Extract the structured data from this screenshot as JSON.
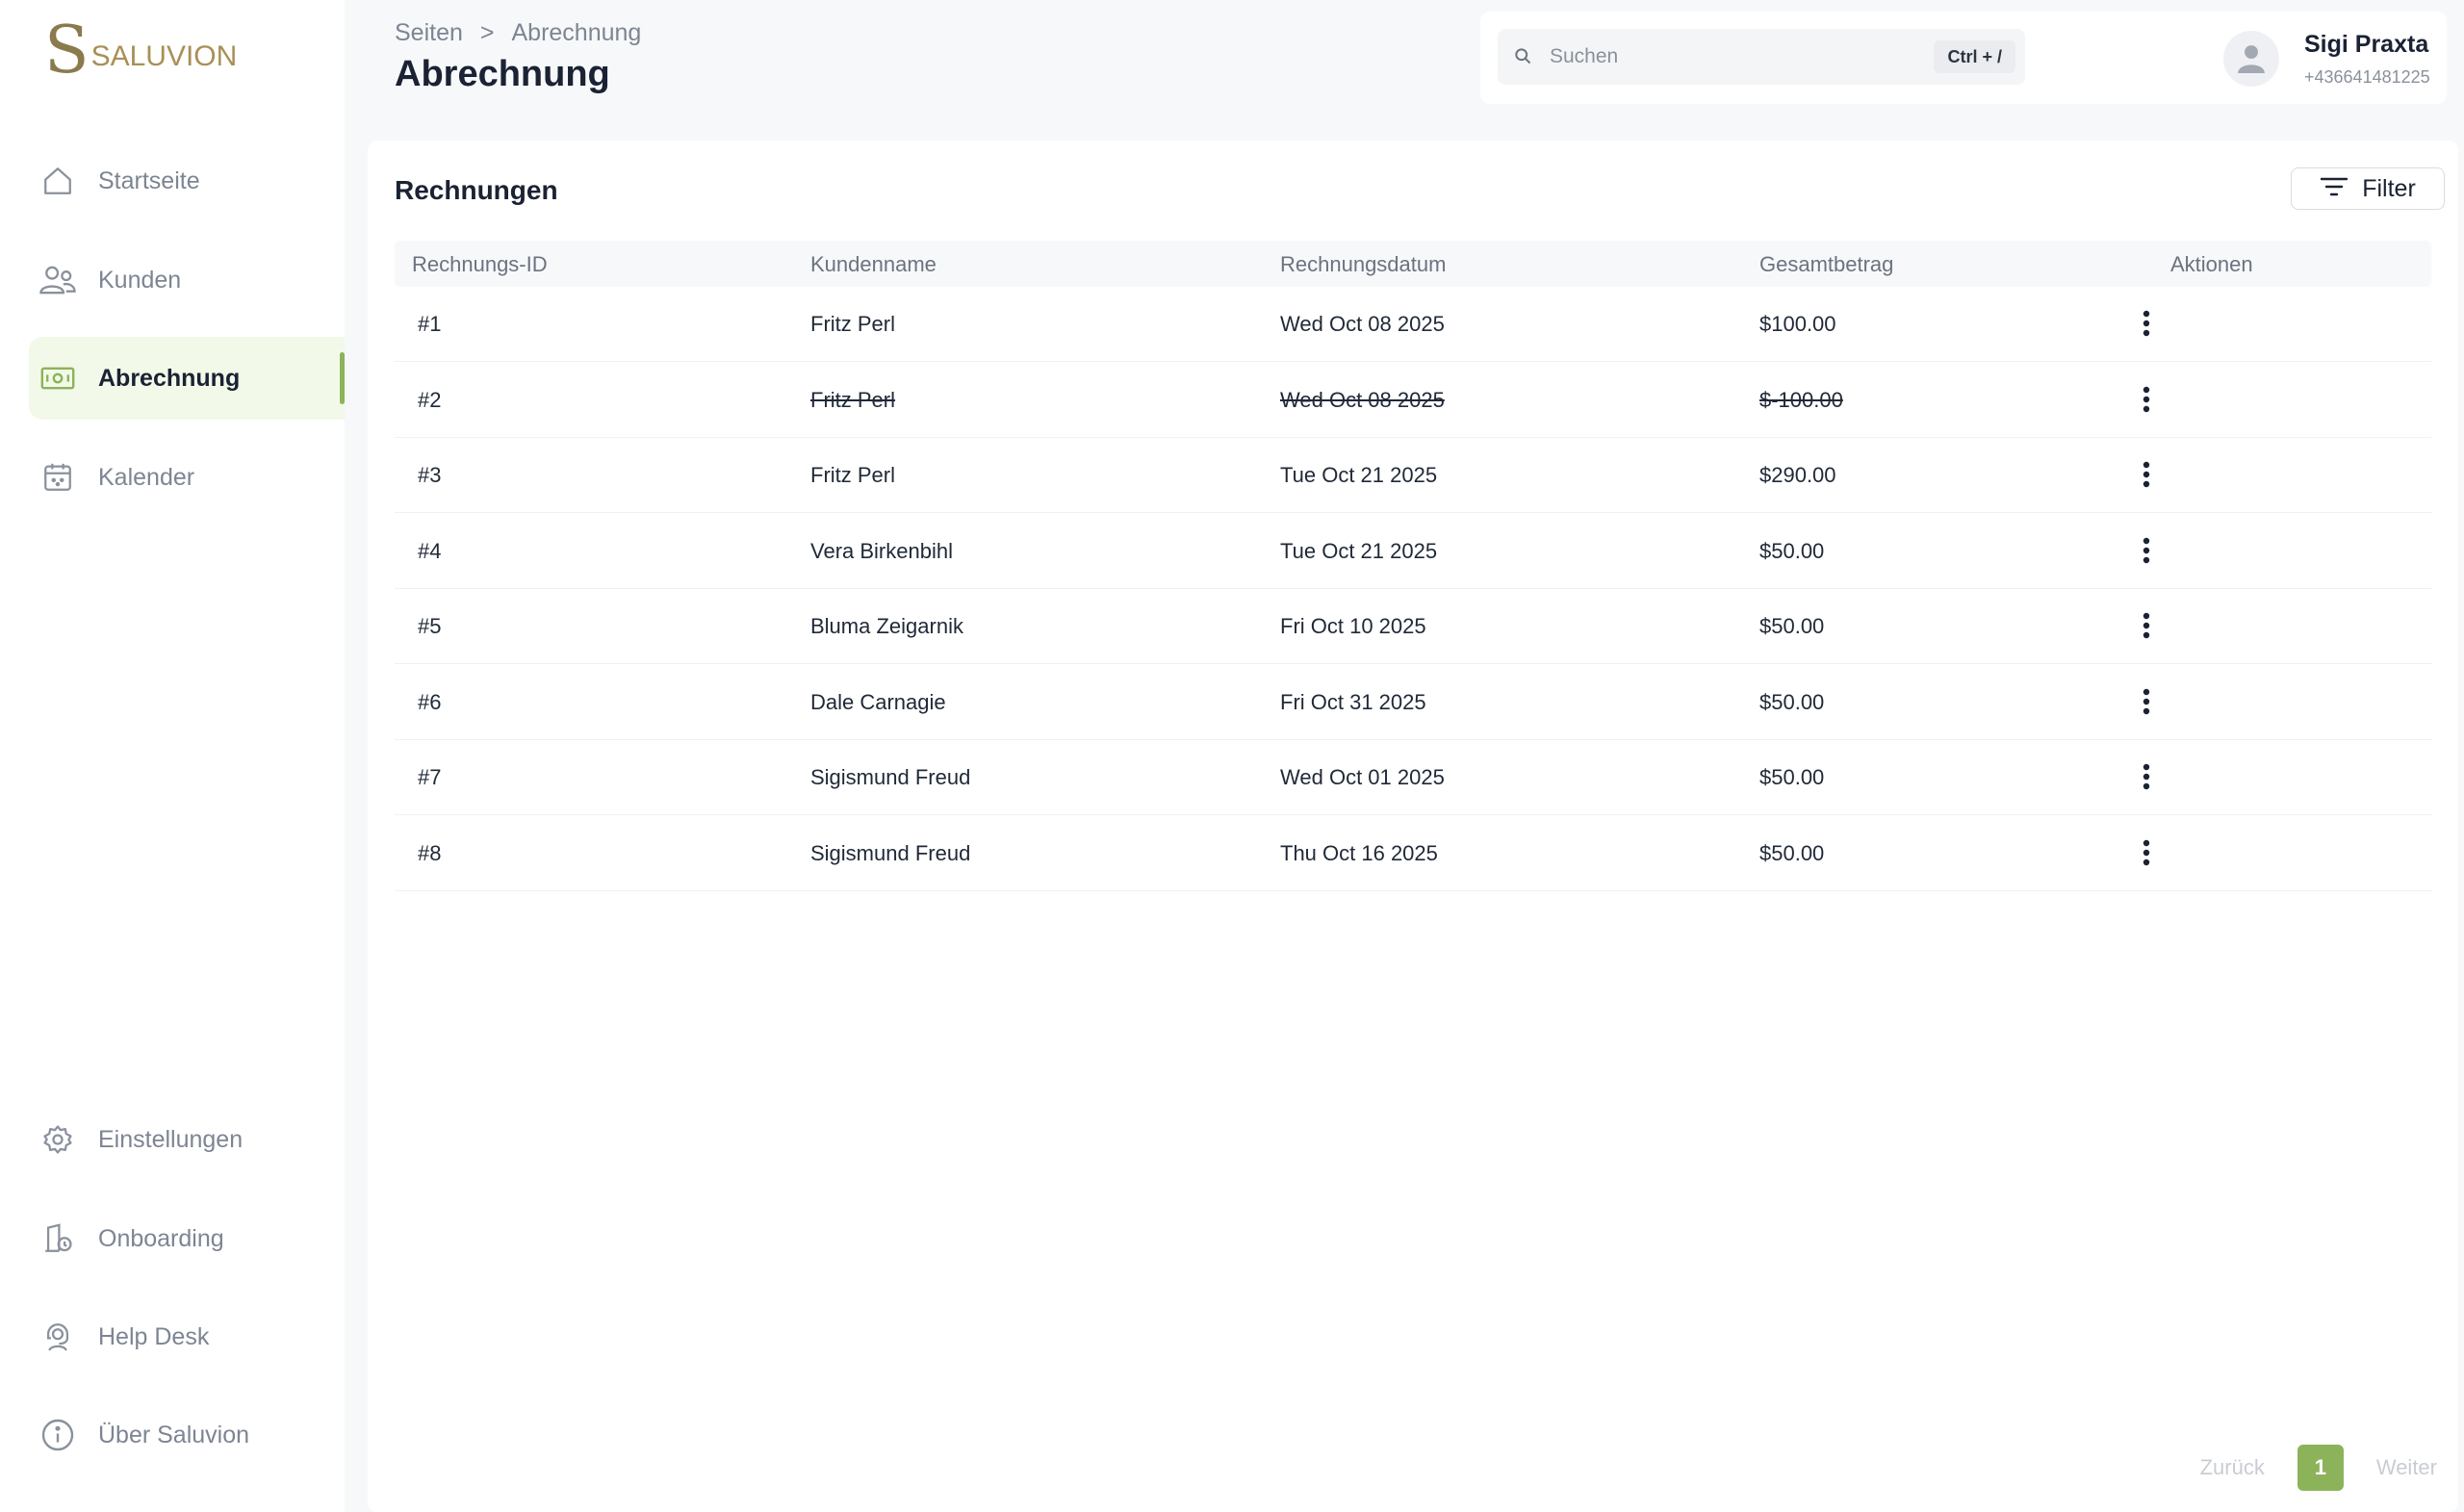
{
  "brand": {
    "logo_letter": "S",
    "logo_text": "SALUVION",
    "accent": "#8cb35a"
  },
  "sidebar": {
    "items": [
      {
        "label": "Startseite",
        "icon": "home-icon"
      },
      {
        "label": "Kunden",
        "icon": "users-icon"
      },
      {
        "label": "Abrechnung",
        "icon": "banknote-icon",
        "active": true
      },
      {
        "label": "Kalender",
        "icon": "calendar-icon"
      }
    ],
    "bottom_items": [
      {
        "label": "Einstellungen",
        "icon": "gear-icon"
      },
      {
        "label": "Onboarding",
        "icon": "onboarding-icon"
      },
      {
        "label": "Help Desk",
        "icon": "help-desk-icon"
      },
      {
        "label": "Über Saluvion",
        "icon": "info-icon"
      }
    ]
  },
  "header": {
    "breadcrumb": {
      "root": "Seiten",
      "separator": ">",
      "current": "Abrechnung"
    },
    "title": "Abrechnung"
  },
  "search": {
    "placeholder": "Suchen",
    "shortcut": "Ctrl + /"
  },
  "user": {
    "name": "Sigi Praxta",
    "phone": "+436641481225"
  },
  "invoices": {
    "title": "Rechnungen",
    "filter_label": "Filter",
    "columns": [
      "Rechnungs-ID",
      "Kundenname",
      "Rechnungsdatum",
      "Gesamtbetrag",
      "Aktionen"
    ],
    "rows": [
      {
        "id": "#1",
        "customer": "Fritz Perl",
        "date": "Wed Oct 08 2025",
        "amount": "$100.00",
        "cancelled": false
      },
      {
        "id": "#2",
        "customer": "Fritz Perl",
        "date": "Wed Oct 08 2025",
        "amount": "$-100.00",
        "cancelled": true
      },
      {
        "id": "#3",
        "customer": "Fritz Perl",
        "date": "Tue Oct 21 2025",
        "amount": "$290.00",
        "cancelled": false
      },
      {
        "id": "#4",
        "customer": "Vera Birkenbihl",
        "date": "Tue Oct 21 2025",
        "amount": "$50.00",
        "cancelled": false
      },
      {
        "id": "#5",
        "customer": "Bluma Zeigarnik",
        "date": "Fri Oct 10 2025",
        "amount": "$50.00",
        "cancelled": false
      },
      {
        "id": "#6",
        "customer": "Dale Carnagie",
        "date": "Fri Oct 31 2025",
        "amount": "$50.00",
        "cancelled": false
      },
      {
        "id": "#7",
        "customer": "Sigismund Freud",
        "date": "Wed Oct 01 2025",
        "amount": "$50.00",
        "cancelled": false
      },
      {
        "id": "#8",
        "customer": "Sigismund Freud",
        "date": "Thu Oct 16 2025",
        "amount": "$50.00",
        "cancelled": false
      }
    ]
  },
  "pagination": {
    "prev": "Zurück",
    "current": "1",
    "next": "Weiter"
  }
}
